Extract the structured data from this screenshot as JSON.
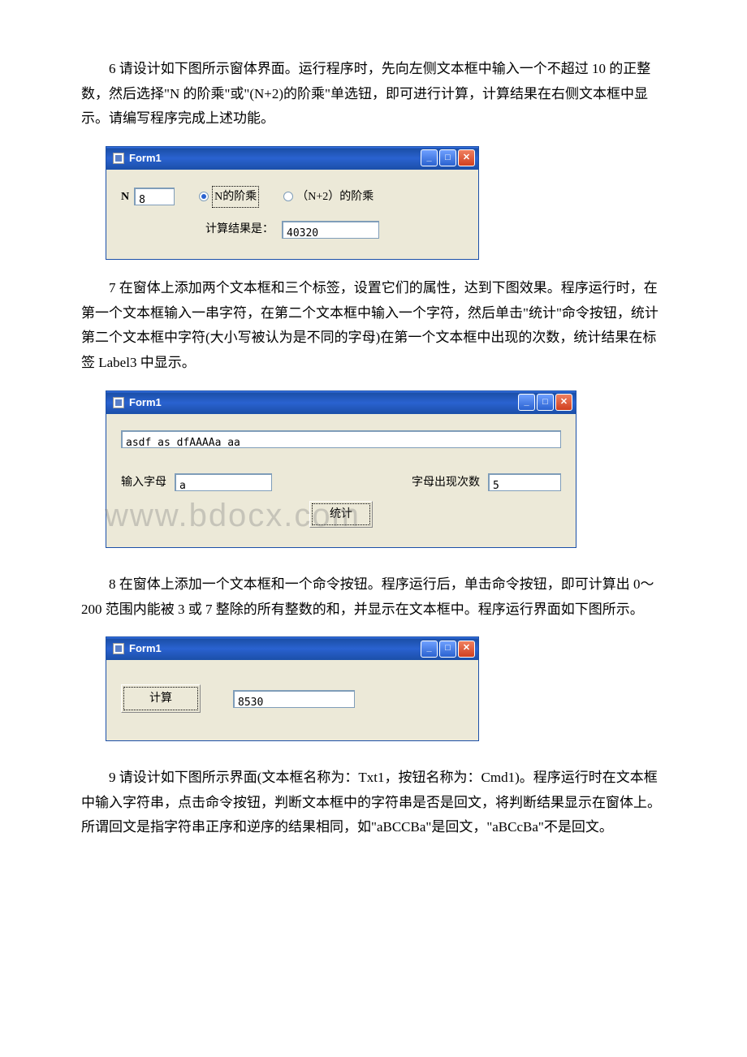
{
  "para1": "6 请设计如下图所示窗体界面。运行程序时，先向左侧文本框中输入一个不超过 10 的正整数，然后选择\"N 的阶乘\"或\"(N+2)的阶乘\"单选钮，即可进行计算，计算结果在右侧文本框中显示。请编写程序完成上述功能。",
  "para2": "7 在窗体上添加两个文本框和三个标签，设置它们的属性，达到下图效果。程序运行时，在第一个文本框输入一串字符，在第二个文本框中输入一个字符，然后单击\"统计\"命令按钮，统计第二个文本框中字符(大小写被认为是不同的字母)在第一个文本框中出现的次数，统计结果在标签 Label3 中显示。",
  "para3": "8 在窗体上添加一个文本框和一个命令按钮。程序运行后，单击命令按钮，即可计算出 0～200 范围内能被 3 或 7 整除的所有整数的和，并显示在文本框中。程序运行界面如下图所示。",
  "para4": "9 请设计如下图所示界面(文本框名称为：Txt1，按钮名称为：Cmd1)。程序运行时在文本框中输入字符串，点击命令按钮，判断文本框中的字符串是否是回文，将判断结果显示在窗体上。所谓回文是指字符串正序和逆序的结果相同，如\"aBCCBa\"是回文，\"aBCcBa\"不是回文。",
  "form_title": "Form1",
  "win1": {
    "label_n": "N",
    "input_n": "8",
    "radio1": "N的阶乘",
    "radio2": "（N+2）的阶乘",
    "result_label": "计算结果是：",
    "result": "40320"
  },
  "win2": {
    "text1": "asdf as dfAAAAa aa",
    "label1": "输入字母",
    "input_letter": "a",
    "label2": "字母出现次数",
    "count": "5",
    "button": "统计"
  },
  "win3": {
    "button": "计算",
    "result": "8530"
  },
  "watermark": "www.bdocx.com"
}
